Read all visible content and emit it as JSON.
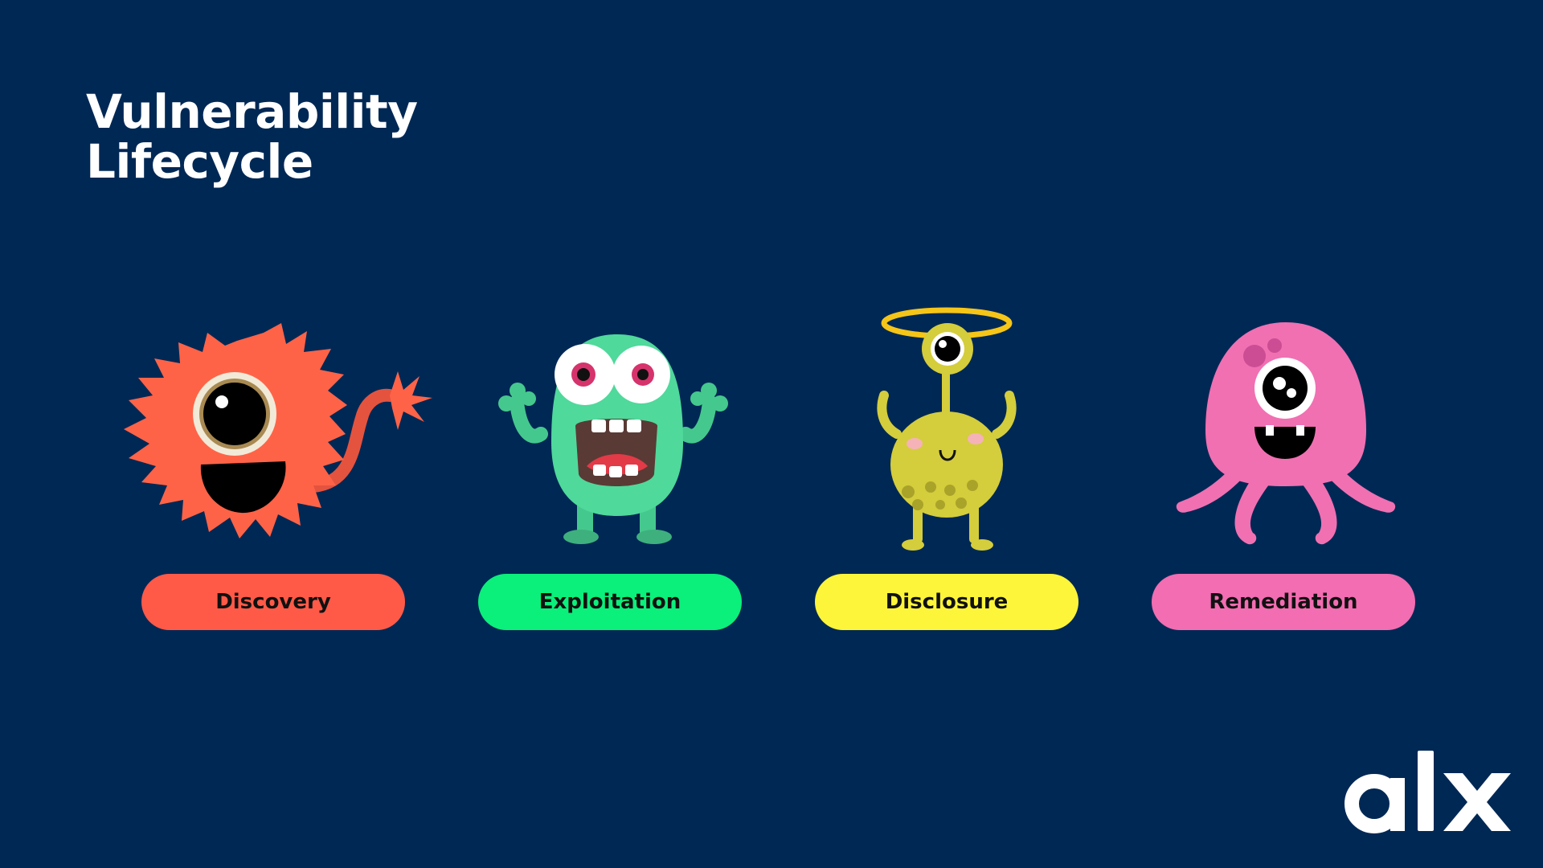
{
  "title": {
    "line1": "Vulnerability",
    "line2": "Lifecycle"
  },
  "stages": [
    {
      "label": "Discovery",
      "color": "#ff5a48",
      "icon": "orange-furry-monster-icon"
    },
    {
      "label": "Exploitation",
      "color": "#0bef7b",
      "icon": "green-screaming-monster-icon"
    },
    {
      "label": "Disclosure",
      "color": "#fdf53a",
      "icon": "yellow-halo-monster-icon"
    },
    {
      "label": "Remediation",
      "color": "#f26db1",
      "icon": "pink-octopus-monster-icon"
    }
  ],
  "logo": {
    "text": "alx",
    "color": "#ffffff"
  }
}
